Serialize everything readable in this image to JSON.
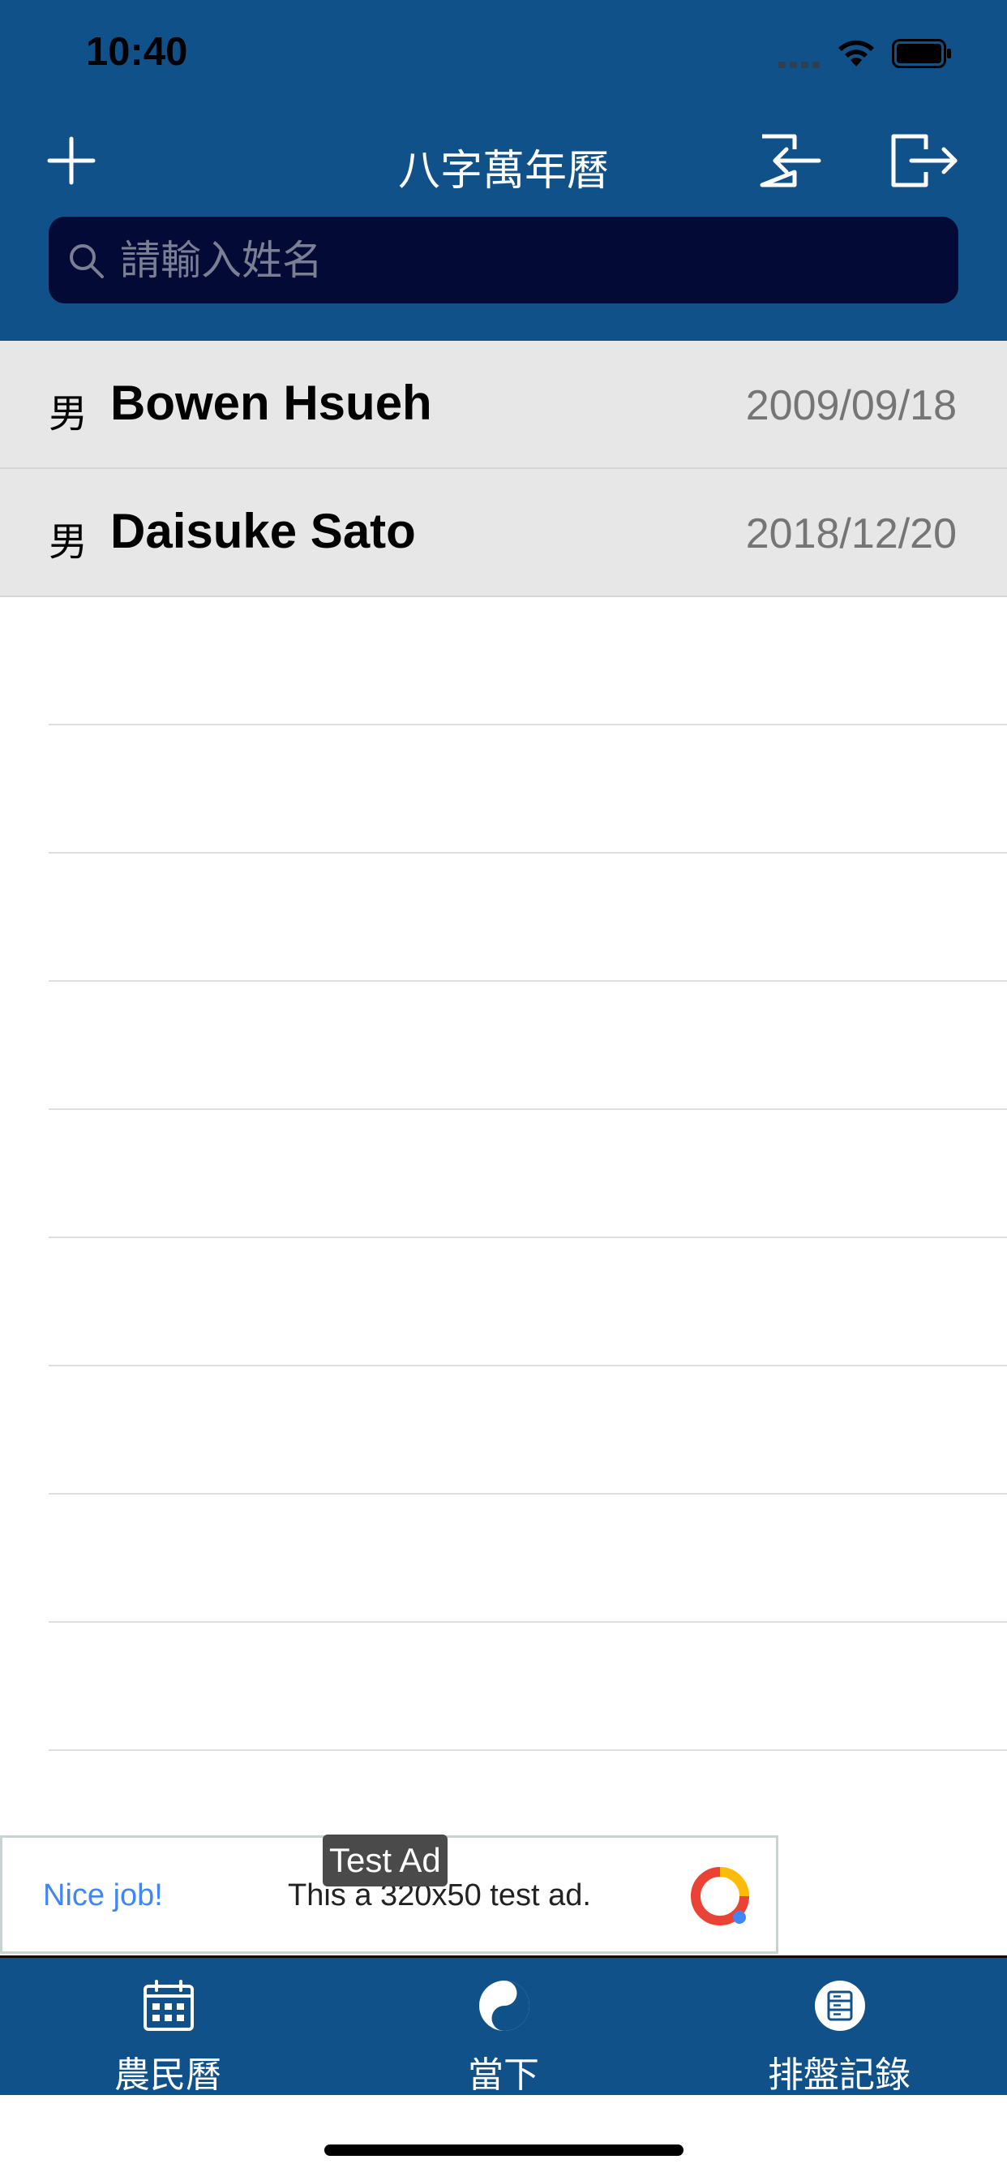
{
  "status_bar": {
    "time": "10:40"
  },
  "header": {
    "title": "八字萬年曆",
    "add_icon": "plus-icon",
    "import_icon": "import-icon",
    "export_icon": "export-icon"
  },
  "search": {
    "placeholder": "請輸入姓名",
    "value": ""
  },
  "records": [
    {
      "gender": "男",
      "name": "Bowen Hsueh",
      "date": "2009/09/18"
    },
    {
      "gender": "男",
      "name": "Daisuke Sato",
      "date": "2018/12/20"
    }
  ],
  "ad": {
    "tag": "Test Ad",
    "headline": "Nice job!",
    "text": "This a 320x50 test ad."
  },
  "tabbar": {
    "tabs": [
      {
        "label": "農民曆",
        "icon": "calendar-icon"
      },
      {
        "label": "當下",
        "icon": "yin-yang-icon"
      },
      {
        "label": "排盤記錄",
        "icon": "records-icon"
      }
    ]
  },
  "colors": {
    "header_bg": "#11518A",
    "search_bg": "#020A35",
    "row_bg": "#E7E7E7"
  }
}
